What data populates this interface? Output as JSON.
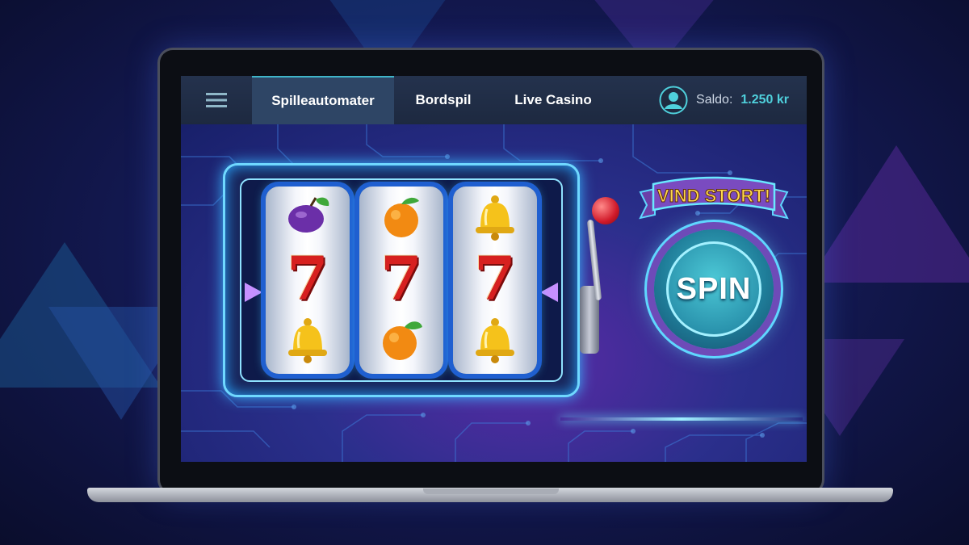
{
  "nav": {
    "tabs": [
      {
        "label": "Spilleautomater",
        "active": true
      },
      {
        "label": "Bordspil",
        "active": false
      },
      {
        "label": "Live Casino",
        "active": false
      }
    ],
    "menu_icon": "hamburger-menu-icon",
    "user_icon": "user-avatar-icon",
    "balance_label": "Saldo:",
    "balance_value": "1.250 kr"
  },
  "slot": {
    "reels": [
      [
        "plum",
        "seven",
        "bell"
      ],
      [
        "orange",
        "seven",
        "orange"
      ],
      [
        "bell",
        "seven",
        "bell"
      ]
    ],
    "seven_glyph": "7"
  },
  "banner_text": "VIND STORT!",
  "spin_label": "SPIN",
  "colors": {
    "accent": "#4fd0dc",
    "seven_red": "#d7201f",
    "neon_blue": "#6fd8ff",
    "spin_teal": "#2a93ad"
  }
}
